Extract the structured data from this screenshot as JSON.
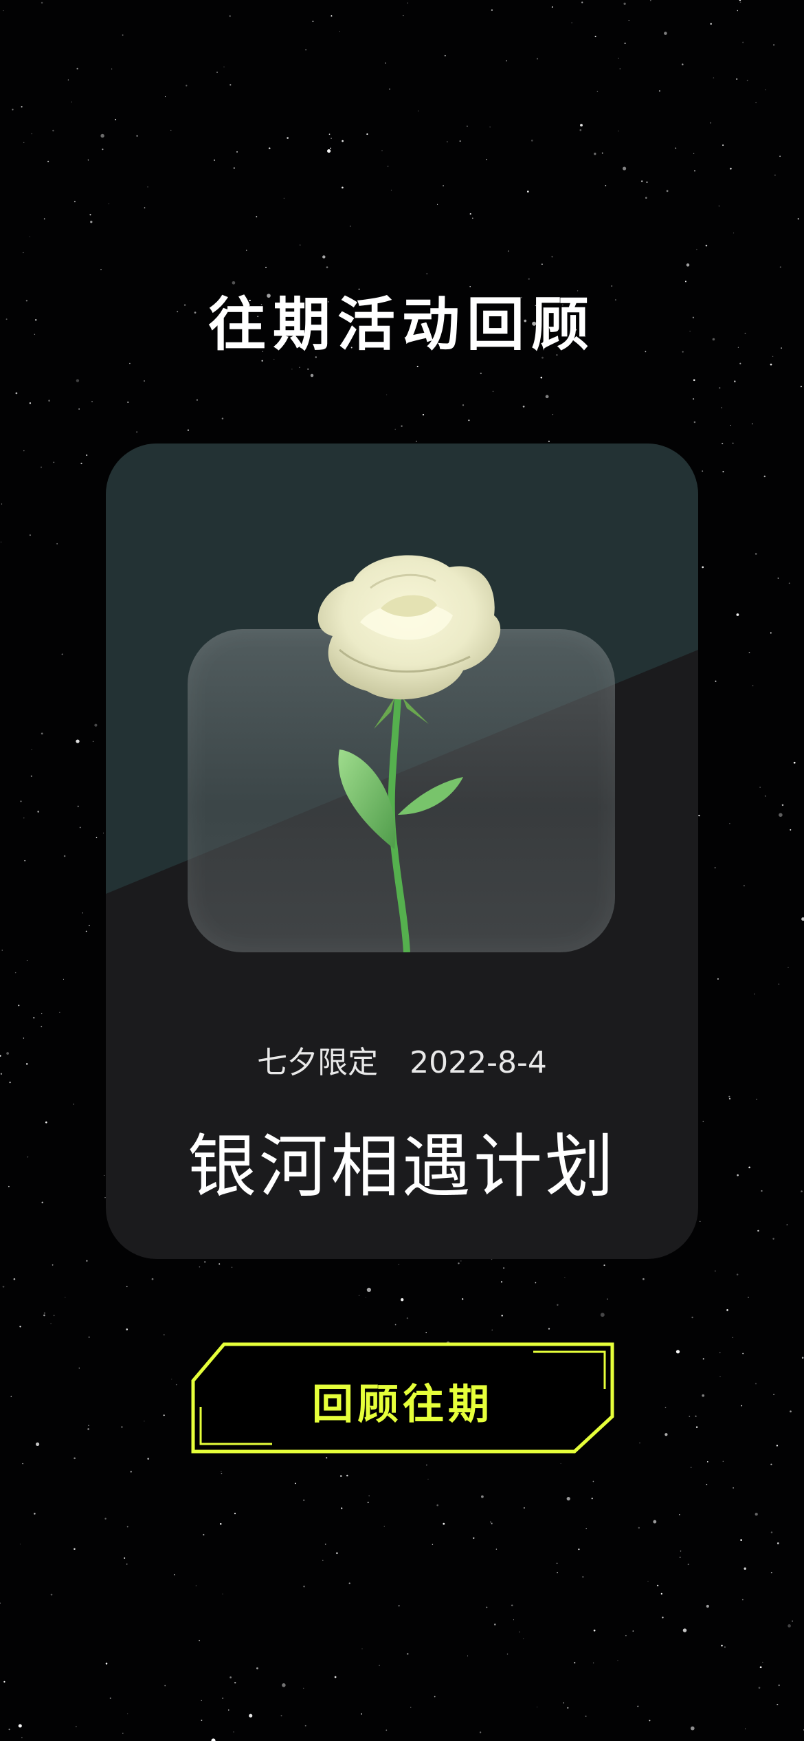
{
  "page": {
    "title": "往期活动回顾"
  },
  "event_card": {
    "tag": "七夕限定",
    "date": "2022-8-4",
    "title": "银河相遇计划",
    "image": "white-rose"
  },
  "review_button": {
    "label": "回顾往期"
  },
  "colors": {
    "background": "#020203",
    "card": "#1b1b1d",
    "card_top": "#233234",
    "accent": "#e6ff3a",
    "text": "#ffffff"
  }
}
